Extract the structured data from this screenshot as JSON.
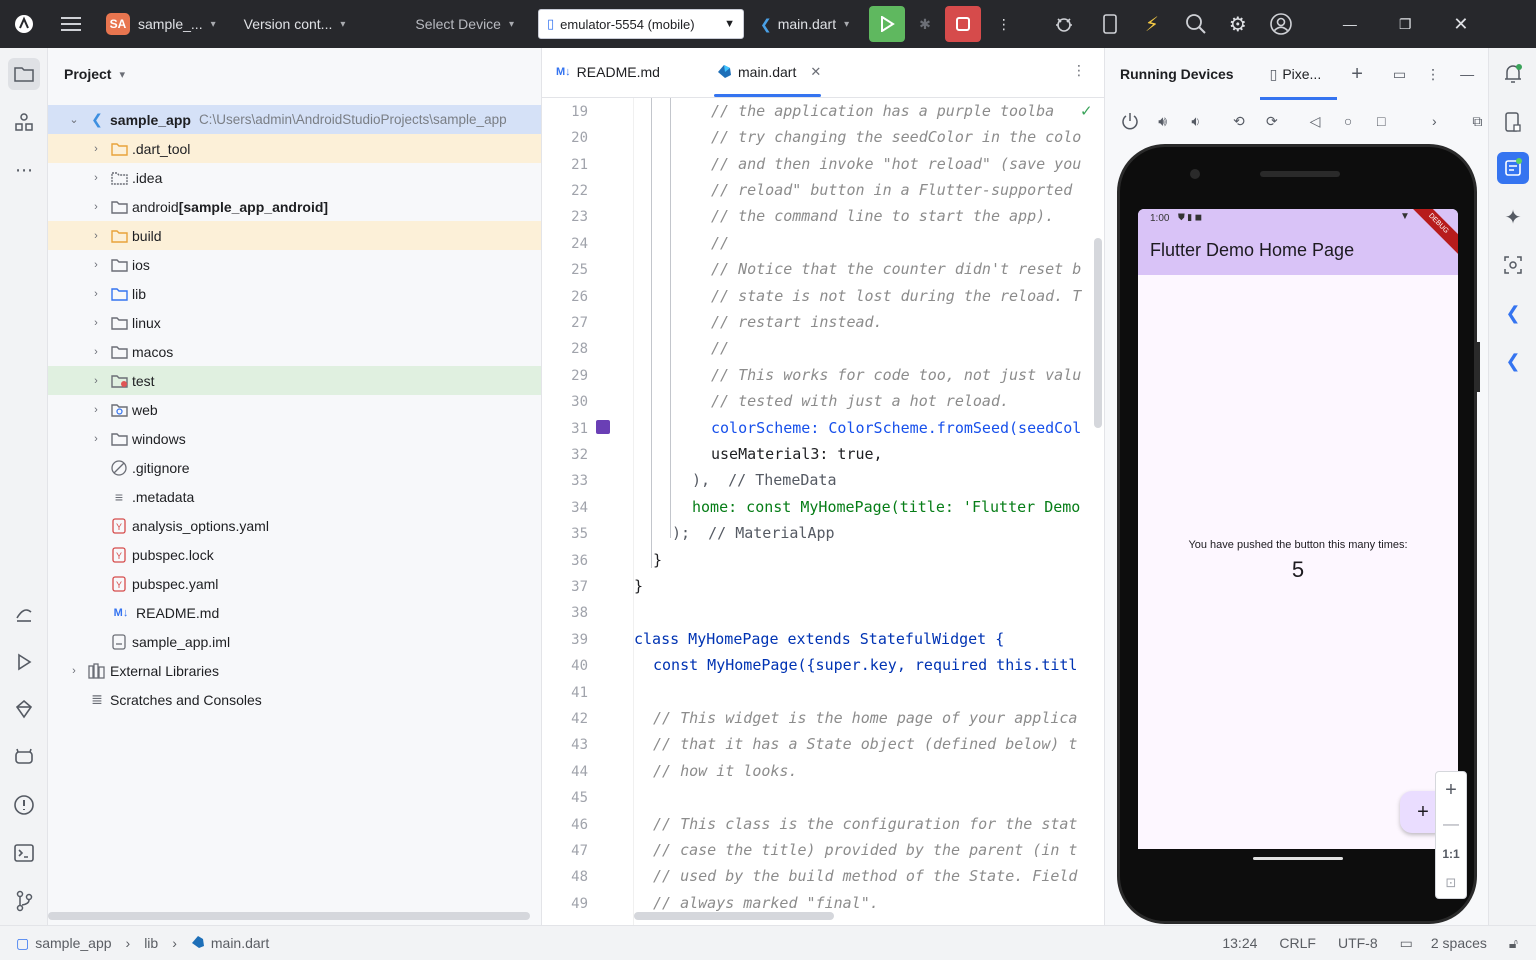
{
  "titlebar": {
    "project_badge": "SA",
    "project_name": "sample_...",
    "vcs": "Version cont...",
    "select_device": "Select Device",
    "device": "emulator-5554 (mobile)",
    "run_config": "main.dart"
  },
  "project_panel": {
    "title": "Project",
    "root": {
      "name": "sample_app",
      "path": "C:\\Users\\admin\\AndroidStudioProjects\\sample_app"
    },
    "items": [
      {
        "label": ".dart_tool",
        "bold": ""
      },
      {
        "label": ".idea",
        "bold": ""
      },
      {
        "label": "android ",
        "bold": "[sample_app_android]"
      },
      {
        "label": "build",
        "bold": ""
      },
      {
        "label": "ios",
        "bold": ""
      },
      {
        "label": "lib",
        "bold": ""
      },
      {
        "label": "linux",
        "bold": ""
      },
      {
        "label": "macos",
        "bold": ""
      },
      {
        "label": "test",
        "bold": ""
      },
      {
        "label": "web",
        "bold": ""
      },
      {
        "label": "windows",
        "bold": ""
      },
      {
        "label": ".gitignore",
        "bold": ""
      },
      {
        "label": ".metadata",
        "bold": ""
      },
      {
        "label": "analysis_options.yaml",
        "bold": ""
      },
      {
        "label": "pubspec.lock",
        "bold": ""
      },
      {
        "label": "pubspec.yaml",
        "bold": ""
      },
      {
        "label": "README.md",
        "bold": ""
      },
      {
        "label": "sample_app.iml",
        "bold": ""
      }
    ],
    "external_libraries": "External Libraries",
    "scratches": "Scratches and Consoles"
  },
  "editor": {
    "tabs": [
      {
        "label": "README.md",
        "icon": "M↓"
      },
      {
        "label": "main.dart",
        "icon": "dart"
      }
    ],
    "line_numbers": [
      "19",
      "20",
      "21",
      "22",
      "23",
      "24",
      "25",
      "26",
      "27",
      "28",
      "29",
      "30",
      "31",
      "32",
      "33",
      "34",
      "35",
      "36",
      "37",
      "38",
      "39",
      "40",
      "41",
      "42",
      "43",
      "44",
      "45",
      "46",
      "47",
      "48",
      "49"
    ],
    "lines": [
      "// the application has a purple toolba",
      "// try changing the seedColor in the colo",
      "// and then invoke \"hot reload\" (save you",
      "// reload\" button in a Flutter-supported",
      "// the command line to start the app).",
      "//",
      "// Notice that the counter didn't reset b",
      "// state is not lost during the reload. T",
      "// restart instead.",
      "//",
      "// This works for code too, not just valu",
      "// tested with just a hot reload.",
      "colorScheme: ColorScheme.fromSeed(seedCol",
      "useMaterial3: true,",
      "),  // ThemeData",
      "home: const MyHomePage(title: 'Flutter Demo",
      ");  // MaterialApp",
      "}",
      "}",
      "",
      "class MyHomePage extends StatefulWidget {",
      "const MyHomePage({super.key, required this.titl",
      "",
      "// This widget is the home page of your applica",
      "// that it has a State object (defined below) t",
      "// how it looks.",
      "",
      "// This class is the configuration for the stat",
      "// case the title) provided by the parent (in t",
      "// used by the build method of the State. Field",
      "// always marked \"final\"."
    ]
  },
  "running_devices": {
    "title": "Running Devices",
    "device_tab": "Pixe..."
  },
  "app": {
    "status_time": "1:00",
    "debug_banner": "DEBUG",
    "title": "Flutter Demo Home Page",
    "counter_label": "You have pushed the button this many times:",
    "counter_value": "5",
    "fab": "+",
    "zoom_reset": "1:1",
    "accent": "#d9c3f7"
  },
  "statusbar": {
    "crumbs": [
      "sample_app",
      "lib",
      "main.dart"
    ],
    "position": "13:24",
    "line_sep": "CRLF",
    "encoding": "UTF-8",
    "indent": "2 spaces"
  }
}
